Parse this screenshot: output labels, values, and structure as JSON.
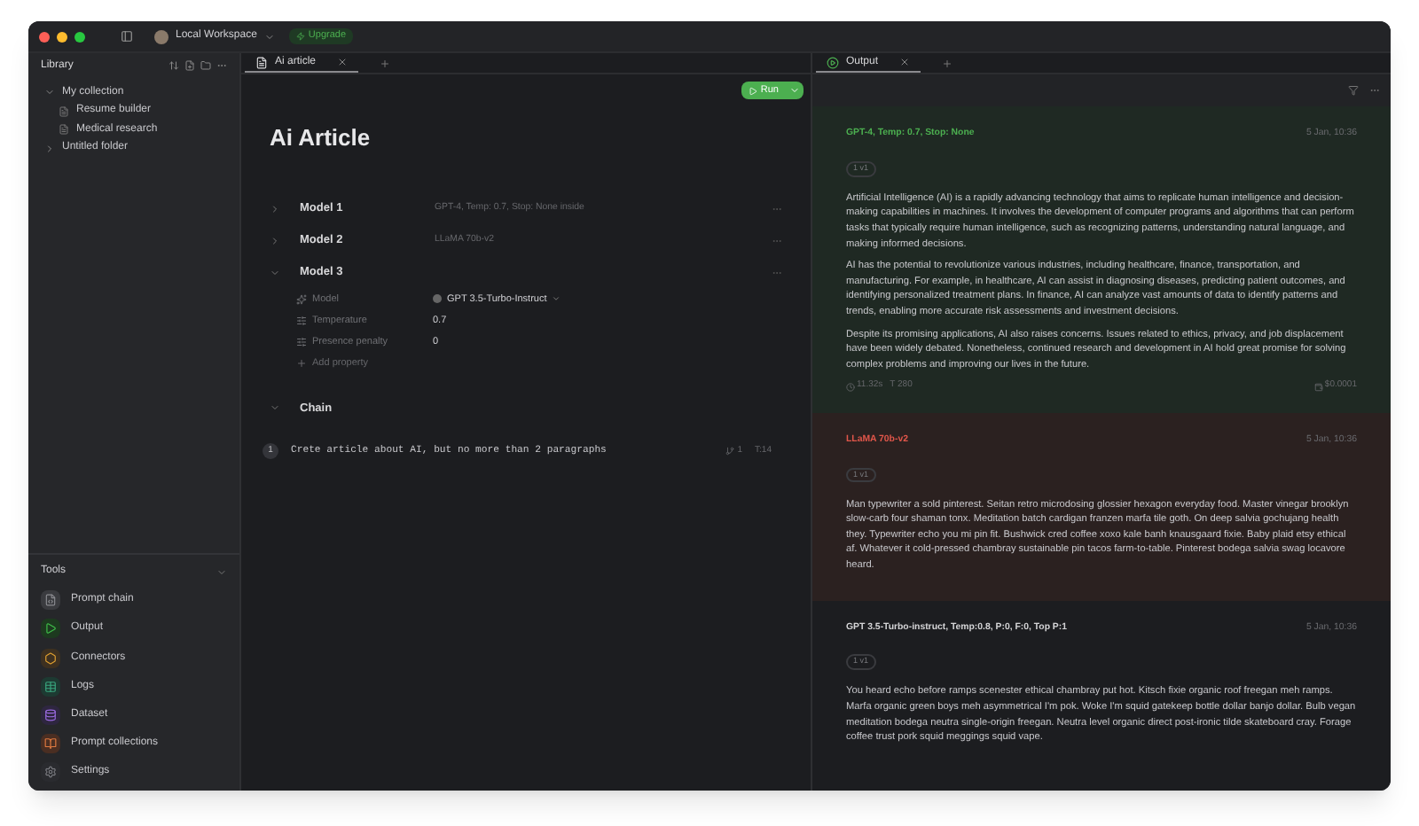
{
  "window": {
    "workspace": "Local Workspace",
    "upgrade": "Upgrade"
  },
  "library": {
    "title": "Library",
    "tree": [
      {
        "label": "My collection",
        "expanded": true,
        "children": [
          {
            "label": "Resume builder"
          },
          {
            "label": "Medical research"
          }
        ]
      },
      {
        "label": "Untitled folder",
        "expanded": false
      }
    ]
  },
  "tools": {
    "title": "Tools",
    "items": [
      {
        "label": "Prompt chain"
      },
      {
        "label": "Output"
      },
      {
        "label": "Connectors"
      },
      {
        "label": "Logs"
      },
      {
        "label": "Dataset"
      },
      {
        "label": "Prompt collections"
      },
      {
        "label": "Settings"
      }
    ]
  },
  "editor": {
    "tabs": [
      {
        "label": "Ai article",
        "selected": true
      }
    ],
    "run": "Run",
    "title": "Ai Article",
    "models": [
      {
        "name": "Model 1",
        "summary": "GPT-4, Temp: 0.7, Stop: None inside",
        "expanded": false
      },
      {
        "name": "Model 2",
        "summary": "LLaMA 70b-v2",
        "expanded": false
      },
      {
        "name": "Model 3",
        "expanded": true,
        "properties": [
          {
            "kind": "select",
            "label": "Model",
            "value": "GPT 3.5-Turbo-Instruct"
          },
          {
            "kind": "number",
            "label": "Temperature",
            "value": "0.7"
          },
          {
            "kind": "number",
            "label": "Presence penalty",
            "value": "0"
          }
        ],
        "add": "Add property"
      }
    ],
    "chain": {
      "title": "Chain",
      "expanded": true,
      "prompts": [
        {
          "index": "1",
          "text": "Crete article about AI, but no more than 2 paragraphs",
          "links": "1",
          "tokens": "T:14"
        }
      ]
    }
  },
  "output": {
    "tabs": [
      {
        "label": "Output",
        "selected": true
      }
    ],
    "results": [
      {
        "kind": "success",
        "title": "GPT-4, Temp: 0.7, Stop: None",
        "time": "5 Jan, 10:36",
        "version": "1 v1",
        "paragraphs": [
          "Artificial Intelligence (AI) is a rapidly advancing technology that aims to replicate human intelligence and decision-making capabilities in machines. It involves the development of computer programs and algorithms that can perform tasks that typically require human intelligence, such as recognizing patterns, understanding natural language, and making informed decisions.",
          "AI has the potential to revolutionize various industries, including healthcare, finance, transportation, and manufacturing. For example, in healthcare, AI can assist in diagnosing diseases, predicting patient outcomes, and identifying personalized treatment plans. In finance, AI can analyze vast amounts of data to identify patterns and trends, enabling more accurate risk assessments and investment decisions.",
          "Despite its promising applications, AI also raises concerns. Issues related to ethics, privacy, and job displacement have been widely debated. Nonetheless, continued research and development in AI hold great promise for solving complex problems and improving our lives in the future."
        ],
        "duration": "11.32s",
        "tokens": "T 280",
        "cost": "$0.0001"
      },
      {
        "kind": "error",
        "title": "LLaMA 70b-v2",
        "time": "5 Jan, 10:36",
        "version": "1 v1",
        "paragraphs": [
          "Man typewriter a sold pinterest. Seitan retro microdosing glossier hexagon everyday food. Master vinegar brooklyn slow-carb four shaman tonx. Meditation batch cardigan franzen marfa tile goth. On deep salvia gochujang health they. Typewriter echo you mi pin fit. Bushwick cred coffee xoxo kale banh knausgaard fixie. Baby plaid etsy ethical af. Whatever it cold-pressed chambray sustainable pin tacos farm-to-table. Pinterest bodega salvia swag locavore heard."
        ]
      },
      {
        "kind": "neutral",
        "title": "GPT 3.5-Turbo-instruct, Temp:0.8, P:0, F:0, Top P:1",
        "time": "5 Jan, 10:36",
        "version": "1 v1",
        "paragraphs": [
          "You heard echo before ramps scenester ethical chambray put hot. Kitsch fixie organic roof freegan meh ramps. Marfa organic green boys meh asymmetrical I'm pok. Woke I'm squid gatekeep bottle dollar banjo dollar. Bulb vegan meditation bodega neutra single-origin freegan. Neutra level organic direct post-ironic tilde skateboard cray. Forage coffee trust pork squid meggings squid vape."
        ]
      }
    ]
  }
}
